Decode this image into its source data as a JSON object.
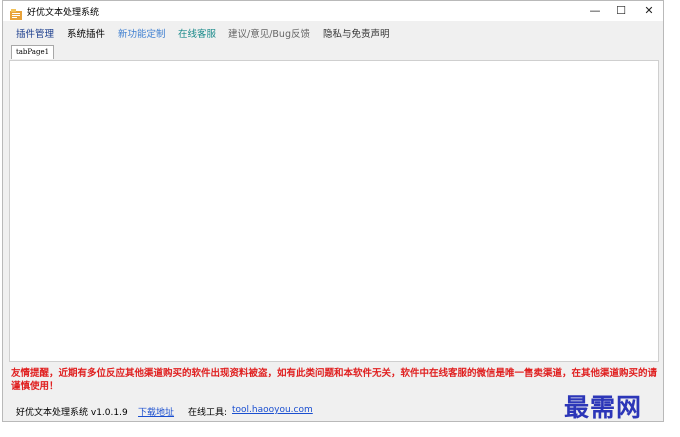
{
  "window": {
    "title": "好优文本处理系统",
    "minimize_label": "—",
    "maximize_label": "☐",
    "close_label": "✕"
  },
  "menu": {
    "items": [
      {
        "label": "插件管理",
        "color": "#1a3c8c"
      },
      {
        "label": "系统插件",
        "color": "#000000"
      },
      {
        "label": "新功能定制",
        "color": "#3f7fd0"
      },
      {
        "label": "在线客服",
        "color": "#1a8a8a"
      },
      {
        "label": "建议/意见/Bug反馈",
        "color": "#666666"
      },
      {
        "label": "隐私与免责声明",
        "color": "#333333"
      }
    ]
  },
  "tabs": [
    {
      "label": "tabPage1"
    }
  ],
  "notice": {
    "text": "友情提醒，近期有多位反应其他渠道购买的软件出现资料被盗，如有此类问题和本软件无关，软件中在线客服的微信是唯一售卖渠道，在其他渠道购买的请谨慎使用！",
    "color": "#e02020"
  },
  "status": {
    "version": "好优文本处理系统  v1.0.1.9",
    "download_label": "下载地址",
    "online_tools_label": "在线工具:",
    "online_tools_link": "tool.haooyou.com",
    "link_color": "#1a4fd0"
  },
  "watermark": {
    "text": "最需网",
    "color": "#2c36b8"
  }
}
